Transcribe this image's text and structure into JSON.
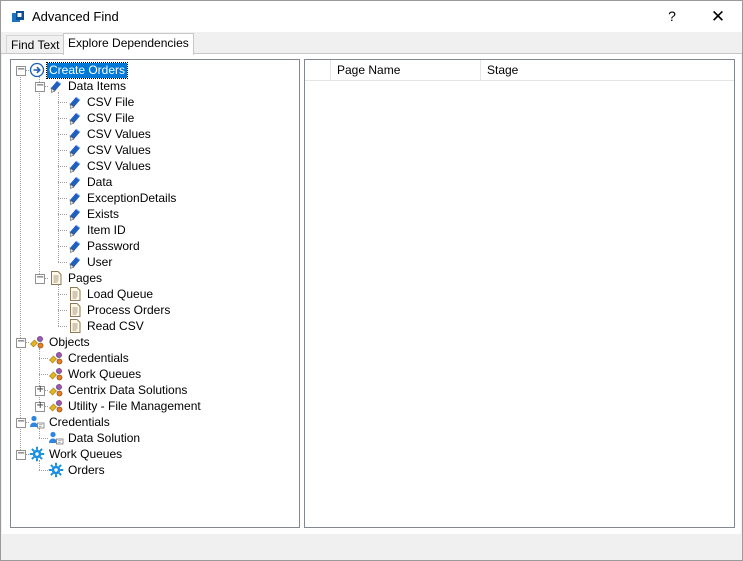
{
  "window": {
    "title": "Advanced Find",
    "help_label": "?",
    "close_label": "✕"
  },
  "tabs": [
    {
      "label": "Find Text",
      "active": false
    },
    {
      "label": "Explore Dependencies",
      "active": true
    }
  ],
  "tree": [
    {
      "label": "Create Orders",
      "icon": "process-icon",
      "selected": true,
      "expanded": true,
      "level": 0,
      "children": [
        {
          "label": "Data Items",
          "icon": "data-item-icon",
          "expanded": true,
          "level": 1
        },
        {
          "label": "CSV File",
          "icon": "data-item-icon",
          "level": 2
        },
        {
          "label": "CSV File",
          "icon": "data-item-icon",
          "level": 2
        },
        {
          "label": "CSV Values",
          "icon": "data-item-icon",
          "level": 2
        },
        {
          "label": "CSV Values",
          "icon": "data-item-icon",
          "level": 2
        },
        {
          "label": "CSV Values",
          "icon": "data-item-icon",
          "level": 2
        },
        {
          "label": "Data",
          "icon": "data-item-icon",
          "level": 2
        },
        {
          "label": "ExceptionDetails",
          "icon": "data-item-icon",
          "level": 2
        },
        {
          "label": "Exists",
          "icon": "data-item-icon",
          "level": 2
        },
        {
          "label": "Item ID",
          "icon": "data-item-icon",
          "level": 2
        },
        {
          "label": "Password",
          "icon": "data-item-icon",
          "level": 2
        },
        {
          "label": "User",
          "icon": "data-item-icon",
          "level": 2
        },
        {
          "label": "Pages",
          "icon": "page-icon",
          "expanded": true,
          "level": 1
        },
        {
          "label": "Load Queue",
          "icon": "page-icon",
          "level": 2
        },
        {
          "label": "Process Orders",
          "icon": "page-icon",
          "level": 2
        },
        {
          "label": "Read CSV",
          "icon": "page-icon",
          "level": 2
        }
      ]
    },
    {
      "label": "Objects",
      "icon": "object-icon",
      "expanded": true,
      "level": 0,
      "children": [
        {
          "label": "Credentials",
          "icon": "object-icon",
          "level": 1
        },
        {
          "label": "Work Queues",
          "icon": "object-icon",
          "level": 1
        },
        {
          "label": "Centrix Data Solutions",
          "icon": "object-icon",
          "expanded": false,
          "level": 1
        },
        {
          "label": "Utility - File Management",
          "icon": "object-icon",
          "expanded": false,
          "level": 1
        }
      ]
    },
    {
      "label": "Credentials",
      "icon": "credential-icon",
      "expanded": true,
      "level": 0,
      "children": [
        {
          "label": "Data Solution",
          "icon": "credential-icon",
          "level": 1
        }
      ]
    },
    {
      "label": "Work Queues",
      "icon": "gear-icon",
      "expanded": true,
      "level": 0,
      "children": [
        {
          "label": "Orders",
          "icon": "gear-icon",
          "level": 1
        }
      ]
    }
  ],
  "list": {
    "columns": [
      "",
      "Page Name",
      "Stage"
    ]
  }
}
